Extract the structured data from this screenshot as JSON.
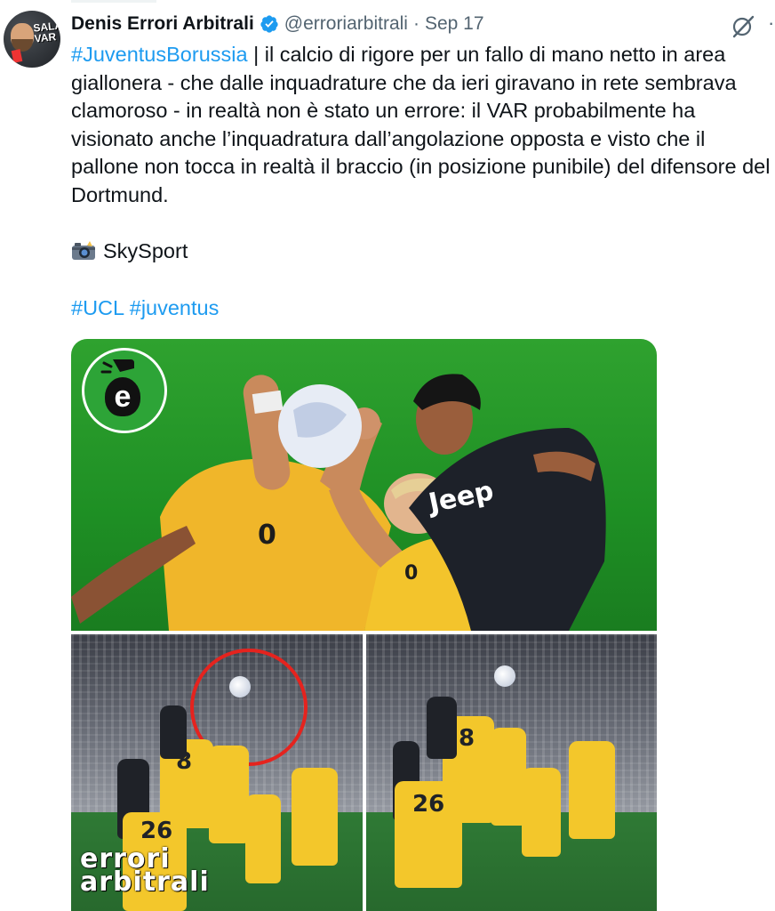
{
  "tweet": {
    "author_name": "Denis Errori Arbitrali",
    "handle": "@erroriarbitrali",
    "separator": "·",
    "date": "Sep 17",
    "more": "·",
    "avatar_text": "SALA VAR",
    "hashtag_main": "#JuventusBorussia",
    "body": " | il calcio di rigore per un fallo di mano netto in area giallonera - che dalle inquadrature che da ieri giravano in rete sembrava clamoroso - in realtà non è stato un errore: il VAR probabilmente ha visionato anche l’inquadratura dall’angolazione opposta e visto che il pallone non tocca in realtà il braccio (in posizione punibile) del difensore del Dortmund.",
    "credit": "SkySport",
    "tags": [
      "#UCL",
      "#juventus"
    ]
  },
  "media": {
    "logo_letter": "e",
    "watermark_line1": "errori",
    "watermark_line2": "arbitrali",
    "jersey_numbers": [
      "8",
      "26",
      "8",
      "26"
    ],
    "highlight_color": "#e5231e",
    "accent_color": "#1d9bf0",
    "kit_color": "#f3c72b"
  },
  "icons": [
    "verified-badge-icon",
    "grok-icon",
    "more-icon",
    "camera-flash-icon"
  ]
}
